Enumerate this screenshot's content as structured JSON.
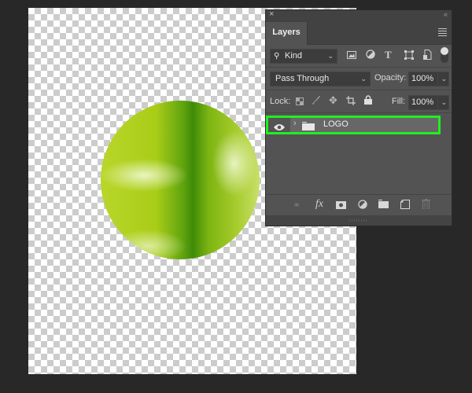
{
  "canvas": {
    "content": "green-circle-logo-image"
  },
  "panel": {
    "close_icon": "×",
    "collapse_icon": "‹‹",
    "tab_label": "Layers",
    "menu_icon": "panel-menu-icon",
    "filter": {
      "kind_label": "Kind",
      "icons": [
        "pixel-filter-icon",
        "adjustment-filter-icon",
        "type-filter-icon",
        "shape-filter-icon",
        "smart-object-filter-icon"
      ],
      "toggle_state": "on"
    },
    "blend_mode": "Pass Through",
    "opacity_label": "Opacity:",
    "opacity_value": "100%",
    "lock_label": "Lock:",
    "lock_icons": [
      "lock-transparent-icon",
      "lock-image-icon",
      "lock-position-icon",
      "lock-artboard-icon",
      "lock-all-icon"
    ],
    "fill_label": "Fill:",
    "fill_value": "100%",
    "layers": [
      {
        "name": "LOGO",
        "type": "group",
        "visible": true,
        "selected": true,
        "highlight_color": "#22ee22"
      }
    ],
    "footer_icons": [
      "link-layers-icon",
      "fx-icon",
      "add-mask-icon",
      "new-adjustment-icon",
      "new-group-icon",
      "new-layer-icon",
      "delete-layer-icon"
    ],
    "footer_labels": {
      "fx": "fx"
    }
  }
}
